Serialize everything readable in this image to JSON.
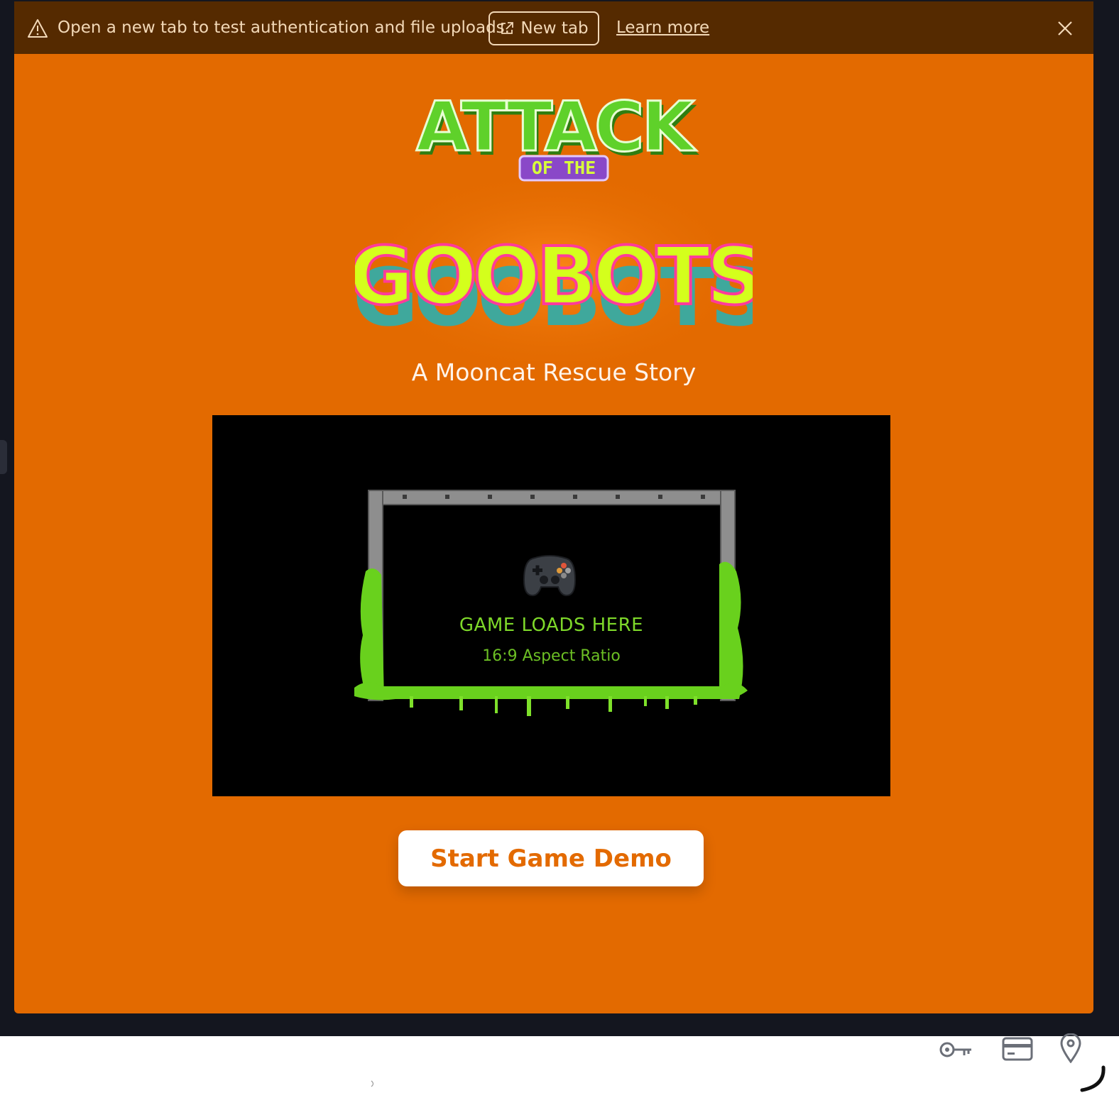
{
  "banner": {
    "message": "Open a new tab to test authentication and file uploads.",
    "new_tab_label": "New tab",
    "learn_more_label": "Learn more",
    "icons": {
      "warning": "warning-triangle-icon",
      "external": "external-link-icon",
      "close": "close-icon"
    }
  },
  "hero": {
    "logo_line1": "ATTACK",
    "logo_line2": "OF THE",
    "logo_line3": "GOOBOTS",
    "subtitle": "A Mooncat Rescue Story"
  },
  "game": {
    "placeholder_title": "GAME LOADS HERE",
    "placeholder_subtitle": "16:9 Aspect Ratio",
    "icon": "game-controller-icon"
  },
  "actions": {
    "start_label": "Start Game Demo"
  },
  "toolbar": {
    "icons": [
      "key-icon",
      "credit-card-icon",
      "location-pin-icon"
    ]
  },
  "colors": {
    "page_orange": "#e36a00",
    "banner_brown": "#552a00",
    "goo_green": "#7ed82a",
    "button_text": "#e36a00"
  }
}
